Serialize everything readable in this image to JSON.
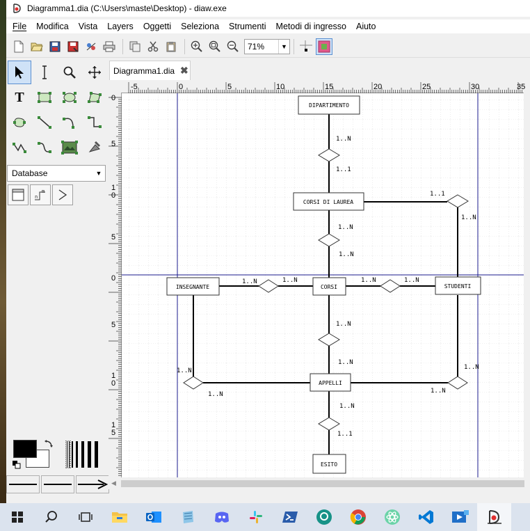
{
  "window": {
    "title": "Diagramma1.dia (C:\\Users\\maste\\Desktop) - diaw.exe"
  },
  "menu": [
    "File",
    "Modifica",
    "Vista",
    "Layers",
    "Oggetti",
    "Seleziona",
    "Strumenti",
    "Metodi di ingresso",
    "Aiuto"
  ],
  "toolbar": {
    "buttons": [
      "new-icon",
      "open-icon",
      "save-icon",
      "save-as-icon",
      "export-icon",
      "print-icon",
      "copy-icon",
      "cut-icon",
      "paste-icon",
      "zoom-in-icon",
      "zoom-fit-icon",
      "zoom-out-icon"
    ],
    "zoom_value": "71%",
    "snap_grid": "snap-to-grid-icon",
    "snap_object": "snap-to-object-icon"
  },
  "toolbox": {
    "tools": [
      "pointer-icon",
      "text-cursor-icon",
      "magnify-icon",
      "move-icon",
      "text-tool-icon",
      "box-icon",
      "ellipse-icon",
      "polygon-icon",
      "beziergon-icon",
      "line-icon",
      "arc-icon",
      "zigzag-icon",
      "polyline-icon",
      "bezier-icon",
      "image-icon",
      "outline-icon"
    ],
    "sheet": "Database",
    "db_tools": [
      "table-icon",
      "reference-icon",
      "compound-icon"
    ]
  },
  "tab": {
    "label": "Diagramma1.dia"
  },
  "rulers": {
    "h_ticks": [
      "-5",
      "0",
      "5",
      "10",
      "15",
      "20",
      "25",
      "30",
      "35"
    ],
    "v_ticks": [
      "0",
      "5",
      "10",
      "5",
      "0",
      "5",
      "10",
      "15"
    ]
  },
  "diagram": {
    "entities": {
      "dipartimento": "DIPARTIMENTO",
      "corsi_di_laurea": "CORSI DI LAUREA",
      "insegnante": "INSEGNANTE",
      "corsi": "CORSI",
      "studenti": "STUDENTI",
      "appelli": "APPELLI",
      "esito": "ESITO"
    },
    "cardinalities": {
      "dip_top": "1..N",
      "dip_bottom": "1..1",
      "cdl_right_top": "1..1",
      "cdl_right_bottom": "1..N",
      "cdl_corsi_top": "1..N",
      "cdl_corsi_bottom": "1..N",
      "ins_left": "1..N",
      "ins_right": "1..N",
      "corsi_stud_left": "1..N",
      "corsi_stud_right": "1..N",
      "corsi_app_top": "1..N",
      "corsi_app_bottom": "1..N",
      "ins_app_top": "1..N",
      "ins_app_bottom": "1..N",
      "stud_app_top": "1..N",
      "stud_app_bottom": "1..N",
      "app_esito_top": "1..N",
      "app_esito_bottom": "1..1"
    }
  },
  "taskbar": [
    "windows-start-icon",
    "search-icon",
    "task-view-icon",
    "file-explorer-icon",
    "outlook-icon",
    "notepad-icon",
    "discord-icon",
    "slack-icon",
    "powershell-icon",
    "gitkraken-icon",
    "chrome-icon",
    "atom-icon",
    "vscode-icon",
    "media-icon",
    "dia-icon"
  ],
  "colors": {
    "accent": "#5a8fd0",
    "guide": "#1a1a8c",
    "grid": "#c8c8c8"
  }
}
